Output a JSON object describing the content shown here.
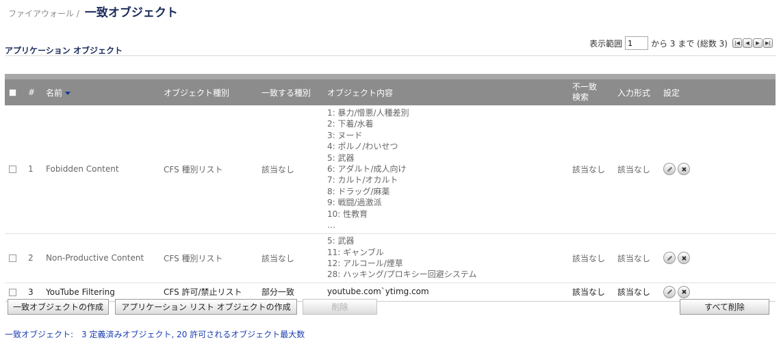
{
  "breadcrumb": {
    "parent": "ファイアウォール /",
    "title": "一致オブジェクト"
  },
  "section": {
    "title": "アプリケーション オブジェクト"
  },
  "pager": {
    "label": "表示範囲",
    "start": "1",
    "suffix": "から 3 まで (総数 3)",
    "nav_icons": [
      "first-page-icon",
      "prev-page-icon",
      "next-page-icon",
      "last-page-icon"
    ]
  },
  "table": {
    "headers": {
      "num": "#",
      "name": "名前",
      "objtype": "オブジェクト種別",
      "matchtype": "一致する種別",
      "contents": "オブジェクト内容",
      "negative": "不一致\n検索",
      "input": "入力形式",
      "settings": "設定"
    },
    "rows": [
      {
        "num": "1",
        "name": "Fobidden Content",
        "objtype": "CFS 種別リスト",
        "matchtype": "該当なし",
        "contents": [
          "1: 暴力/憎悪/人種差別",
          "2: 下着/水着",
          "3: ヌード",
          "4: ポルノ/わいせつ",
          "5: 武器",
          "6: アダルト/成人向け",
          "7: カルト/オカルト",
          "8: ドラッグ/麻薬",
          "9: 戦闘/過激派",
          "10: 性教育",
          "…"
        ],
        "negative": "該当なし",
        "input": "該当なし"
      },
      {
        "num": "2",
        "name": "Non-Productive Content",
        "objtype": "CFS 種別リスト",
        "matchtype": "該当なし",
        "contents": [
          "5: 武器",
          "11: ギャンブル",
          "12: アルコール/煙草",
          "28: ハッキング/プロキシー回避システム"
        ],
        "negative": "該当なし",
        "input": "該当なし"
      },
      {
        "num": "3",
        "name": "YouTube Filtering",
        "objtype": "CFS 許可/禁止リスト",
        "matchtype": "部分一致",
        "contents": [
          "youtube.com`ytimg.com"
        ],
        "negative": "該当なし",
        "input": "該当なし"
      }
    ]
  },
  "buttons": {
    "create_match": "一致オブジェクトの作成",
    "create_app_list": "アプリケーション リスト オブジェクトの作成",
    "delete": "削除",
    "delete_all": "すべて削除"
  },
  "footer": {
    "label": "一致オブジェクト:",
    "text": "3 定義済みオブジェクト, 20 許可されるオブジェクト最大数"
  },
  "colors": {
    "header_bg": "#8c8c8c",
    "title": "#1a2a5a",
    "footer_link": "#1a3fb0"
  }
}
